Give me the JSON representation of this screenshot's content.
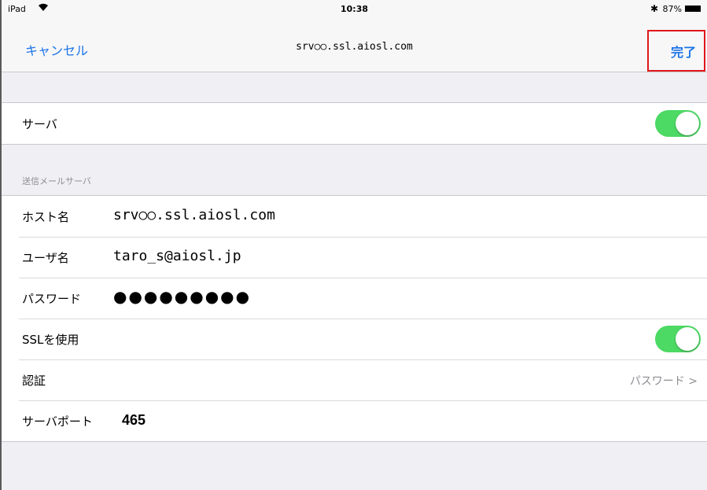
{
  "status_bar": {
    "carrier": "iPad",
    "wifi_icon": "wifi-icon",
    "time": "10:38",
    "bluetooth_icon": "bluetooth-icon",
    "battery_pct": "87%",
    "battery_level": 0.87
  },
  "nav": {
    "cancel_label": "キャンセル",
    "title": "srv○○.ssl.aiosl.com",
    "done_label": "完了",
    "highlight_color": "#e0161b"
  },
  "server_section": {
    "server_label": "サーバ",
    "server_enabled": true
  },
  "outgoing": {
    "header": "送信メールサーバ",
    "rows": {
      "host_label": "ホスト名",
      "host_value": "srv○○.ssl.aiosl.com",
      "user_label": "ユーザ名",
      "user_value": "taro_s@aiosl.jp",
      "password_label": "パスワード",
      "password_value": "●●●●●●●●●",
      "ssl_label": "SSLを使用",
      "ssl_enabled": true,
      "auth_label": "認証",
      "auth_value": "パスワード >",
      "port_label": "サーバポート",
      "port_value": "465"
    }
  },
  "colors": {
    "accent": "#1a73e8",
    "toggle_on": "#4cd964",
    "background": "#efeff4"
  }
}
